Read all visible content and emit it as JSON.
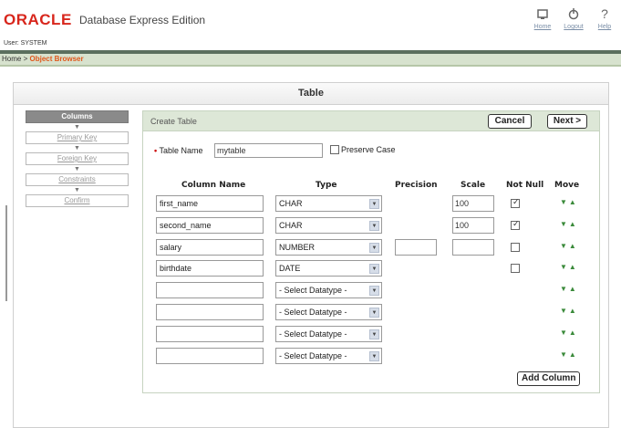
{
  "header": {
    "logo": "ORACLE",
    "product": "Database Express Edition",
    "user": "User: SYSTEM",
    "links": [
      {
        "label": "Home",
        "icon": "home-icon"
      },
      {
        "label": "Logout",
        "icon": "logout-icon"
      },
      {
        "label": "Help",
        "icon": "help-icon"
      }
    ]
  },
  "breadcrumb": {
    "home": "Home",
    "separator": ">",
    "current": "Object Browser"
  },
  "panel": {
    "title": "Table"
  },
  "steps": [
    {
      "label": "Columns",
      "active": true
    },
    {
      "label": "Primary Key",
      "active": false
    },
    {
      "label": "Foreign Key",
      "active": false
    },
    {
      "label": "Constraints",
      "active": false
    },
    {
      "label": "Confirm",
      "active": false
    }
  ],
  "form": {
    "title": "Create Table",
    "cancel_label": "Cancel",
    "next_label": "Next >",
    "table_name_label": "Table Name",
    "table_name_value": "mytable",
    "preserve_case_label": "Preserve Case",
    "headers": {
      "column_name": "Column Name",
      "type": "Type",
      "precision": "Precision",
      "scale": "Scale",
      "not_null": "Not Null",
      "move": "Move"
    },
    "rows": [
      {
        "name": "first_name",
        "type": "CHAR",
        "precision": "",
        "scale": "100",
        "not_null": true,
        "show_precision": false,
        "show_scale": true
      },
      {
        "name": "second_name",
        "type": "CHAR",
        "precision": "",
        "scale": "100",
        "not_null": true,
        "show_precision": false,
        "show_scale": true
      },
      {
        "name": "salary",
        "type": "NUMBER",
        "precision": "",
        "scale": "",
        "not_null": false,
        "show_precision": true,
        "show_scale": true
      },
      {
        "name": "birthdate",
        "type": "DATE",
        "precision": "",
        "scale": "",
        "not_null": false,
        "show_precision": false,
        "show_scale": false
      },
      {
        "name": "",
        "type": "- Select Datatype -",
        "precision": "",
        "scale": "",
        "not_null": null,
        "show_precision": false,
        "show_scale": false
      },
      {
        "name": "",
        "type": "- Select Datatype -",
        "precision": "",
        "scale": "",
        "not_null": null,
        "show_precision": false,
        "show_scale": false
      },
      {
        "name": "",
        "type": "- Select Datatype -",
        "precision": "",
        "scale": "",
        "not_null": null,
        "show_precision": false,
        "show_scale": false
      },
      {
        "name": "",
        "type": "- Select Datatype -",
        "precision": "",
        "scale": "",
        "not_null": null,
        "show_precision": false,
        "show_scale": false
      }
    ],
    "add_column_label": "Add Column",
    "move_arrows": "▼▲"
  },
  "colors": {
    "oracle_red": "#d8261c",
    "crumb_bg": "#d7e2ce",
    "crumb_link": "#e0571a",
    "form_header_bg": "#dde7d7",
    "move_green": "#3a8a3a"
  }
}
